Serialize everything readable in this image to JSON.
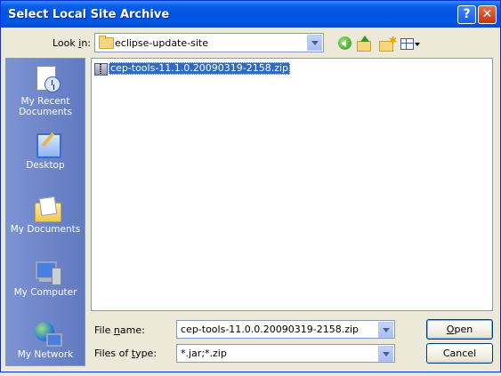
{
  "window": {
    "title": "Select Local Site Archive",
    "help": "?",
    "close": "✕"
  },
  "lookin": {
    "label": "Look in:",
    "value": "eclipse-update-site"
  },
  "places": [
    {
      "label": "My Recent Documents",
      "icon": "recent-documents-icon"
    },
    {
      "label": "Desktop",
      "icon": "desktop-icon"
    },
    {
      "label": "My Documents",
      "icon": "my-documents-icon"
    },
    {
      "label": "My Computer",
      "icon": "my-computer-icon"
    },
    {
      "label": "My Network",
      "icon": "my-network-icon"
    }
  ],
  "files": [
    {
      "name": "cep-tools-11.1.0.20090319-2158.zip",
      "selected": true
    }
  ],
  "filename": {
    "label": "File name:",
    "value": "cep-tools-11.0.0.20090319-2158.zip"
  },
  "filetype": {
    "label": "Files of type:",
    "value": "*.jar;*.zip"
  },
  "buttons": {
    "open": "Open",
    "cancel": "Cancel"
  }
}
